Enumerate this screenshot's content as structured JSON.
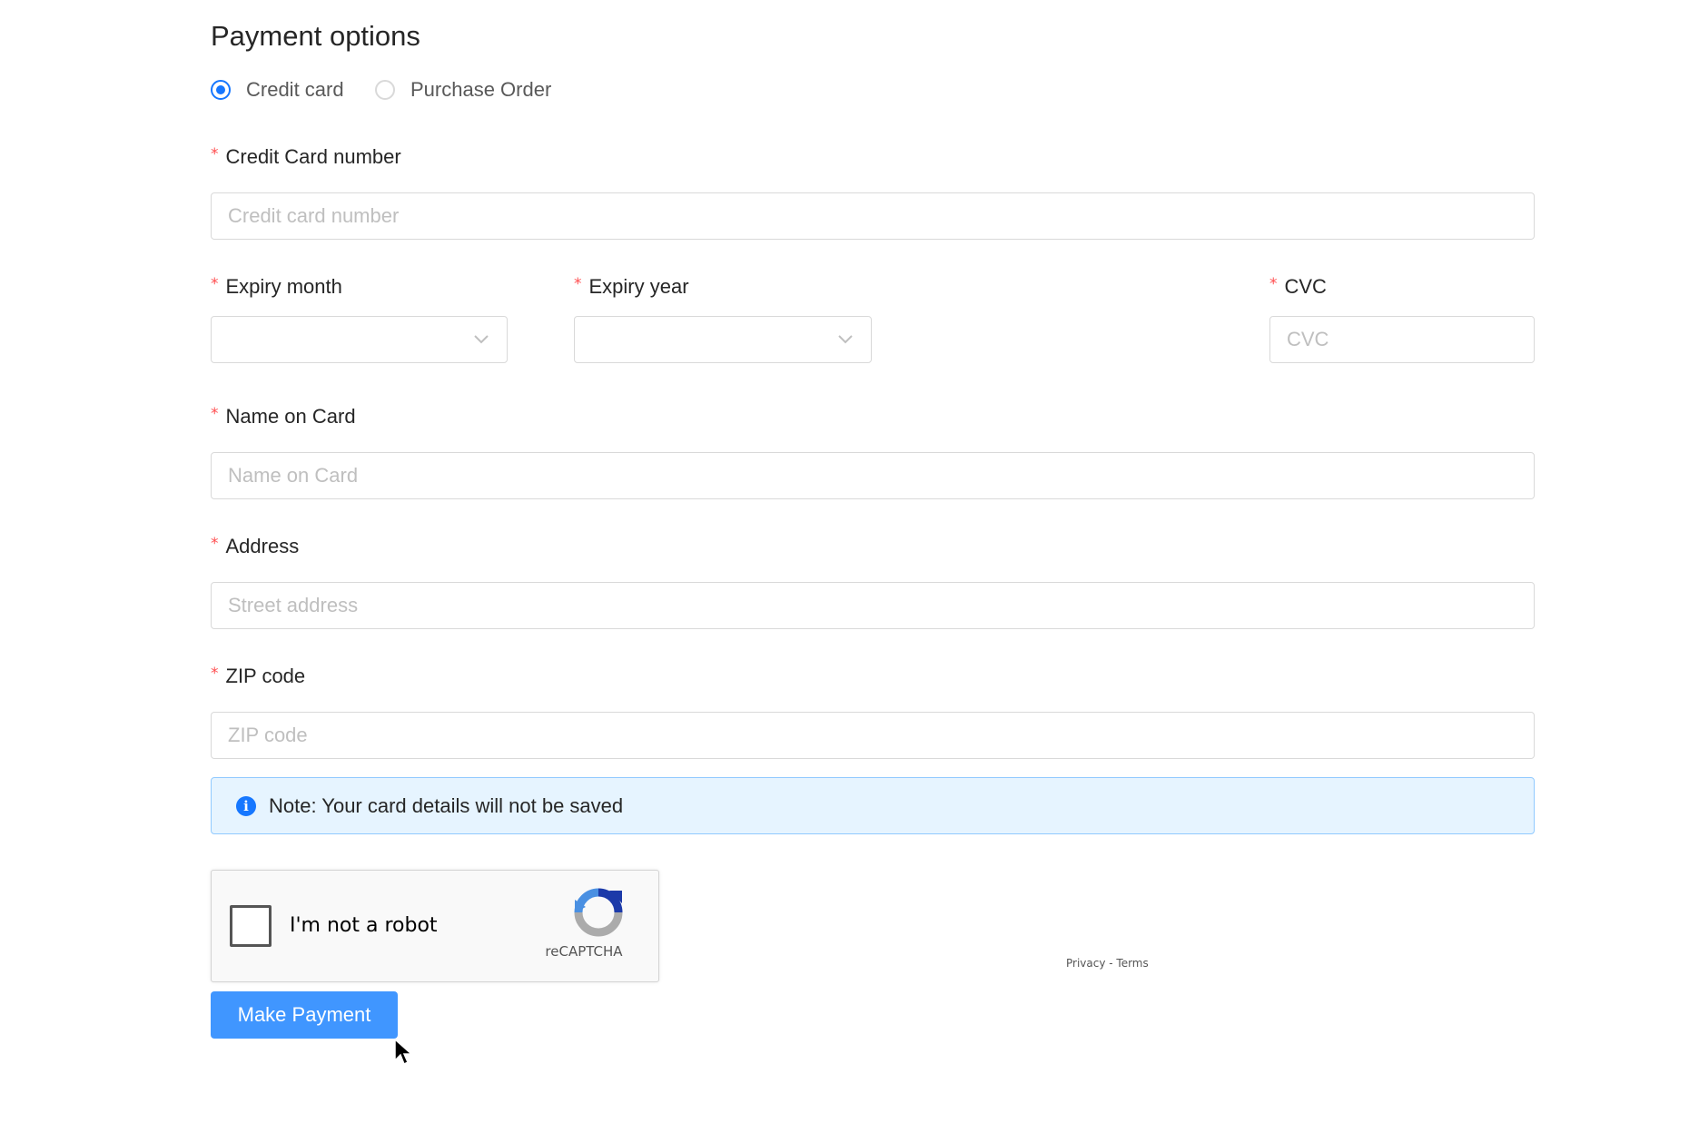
{
  "section": {
    "title": "Payment options"
  },
  "payment_method": {
    "options": [
      {
        "label": "Credit card",
        "selected": true
      },
      {
        "label": "Purchase Order",
        "selected": false
      }
    ]
  },
  "fields": {
    "required_marker": "*",
    "card_number": {
      "label": "Credit Card number",
      "placeholder": "Credit card number",
      "value": ""
    },
    "expiry_month": {
      "label": "Expiry month",
      "value": ""
    },
    "expiry_year": {
      "label": "Expiry year",
      "value": ""
    },
    "cvc": {
      "label": "CVC",
      "placeholder": "CVC",
      "value": ""
    },
    "name_on_card": {
      "label": "Name on Card",
      "placeholder": "Name on Card",
      "value": ""
    },
    "address": {
      "label": "Address",
      "placeholder": "Street address",
      "value": ""
    },
    "zip": {
      "label": "ZIP code",
      "placeholder": "ZIP code",
      "value": ""
    }
  },
  "note": {
    "text": "Note: Your card details will not be saved",
    "icon": "info-icon"
  },
  "recaptcha": {
    "label": "I'm not a robot",
    "brand": "reCAPTCHA",
    "links": "Privacy - Terms",
    "checked": false
  },
  "submit": {
    "label": "Make Payment"
  },
  "colors": {
    "primary": "#1677ff",
    "button": "#4096ff",
    "required": "#ff4d4f",
    "alert_bg": "#e6f4ff",
    "alert_border": "#91caff",
    "input_border": "#d9d9d9"
  }
}
